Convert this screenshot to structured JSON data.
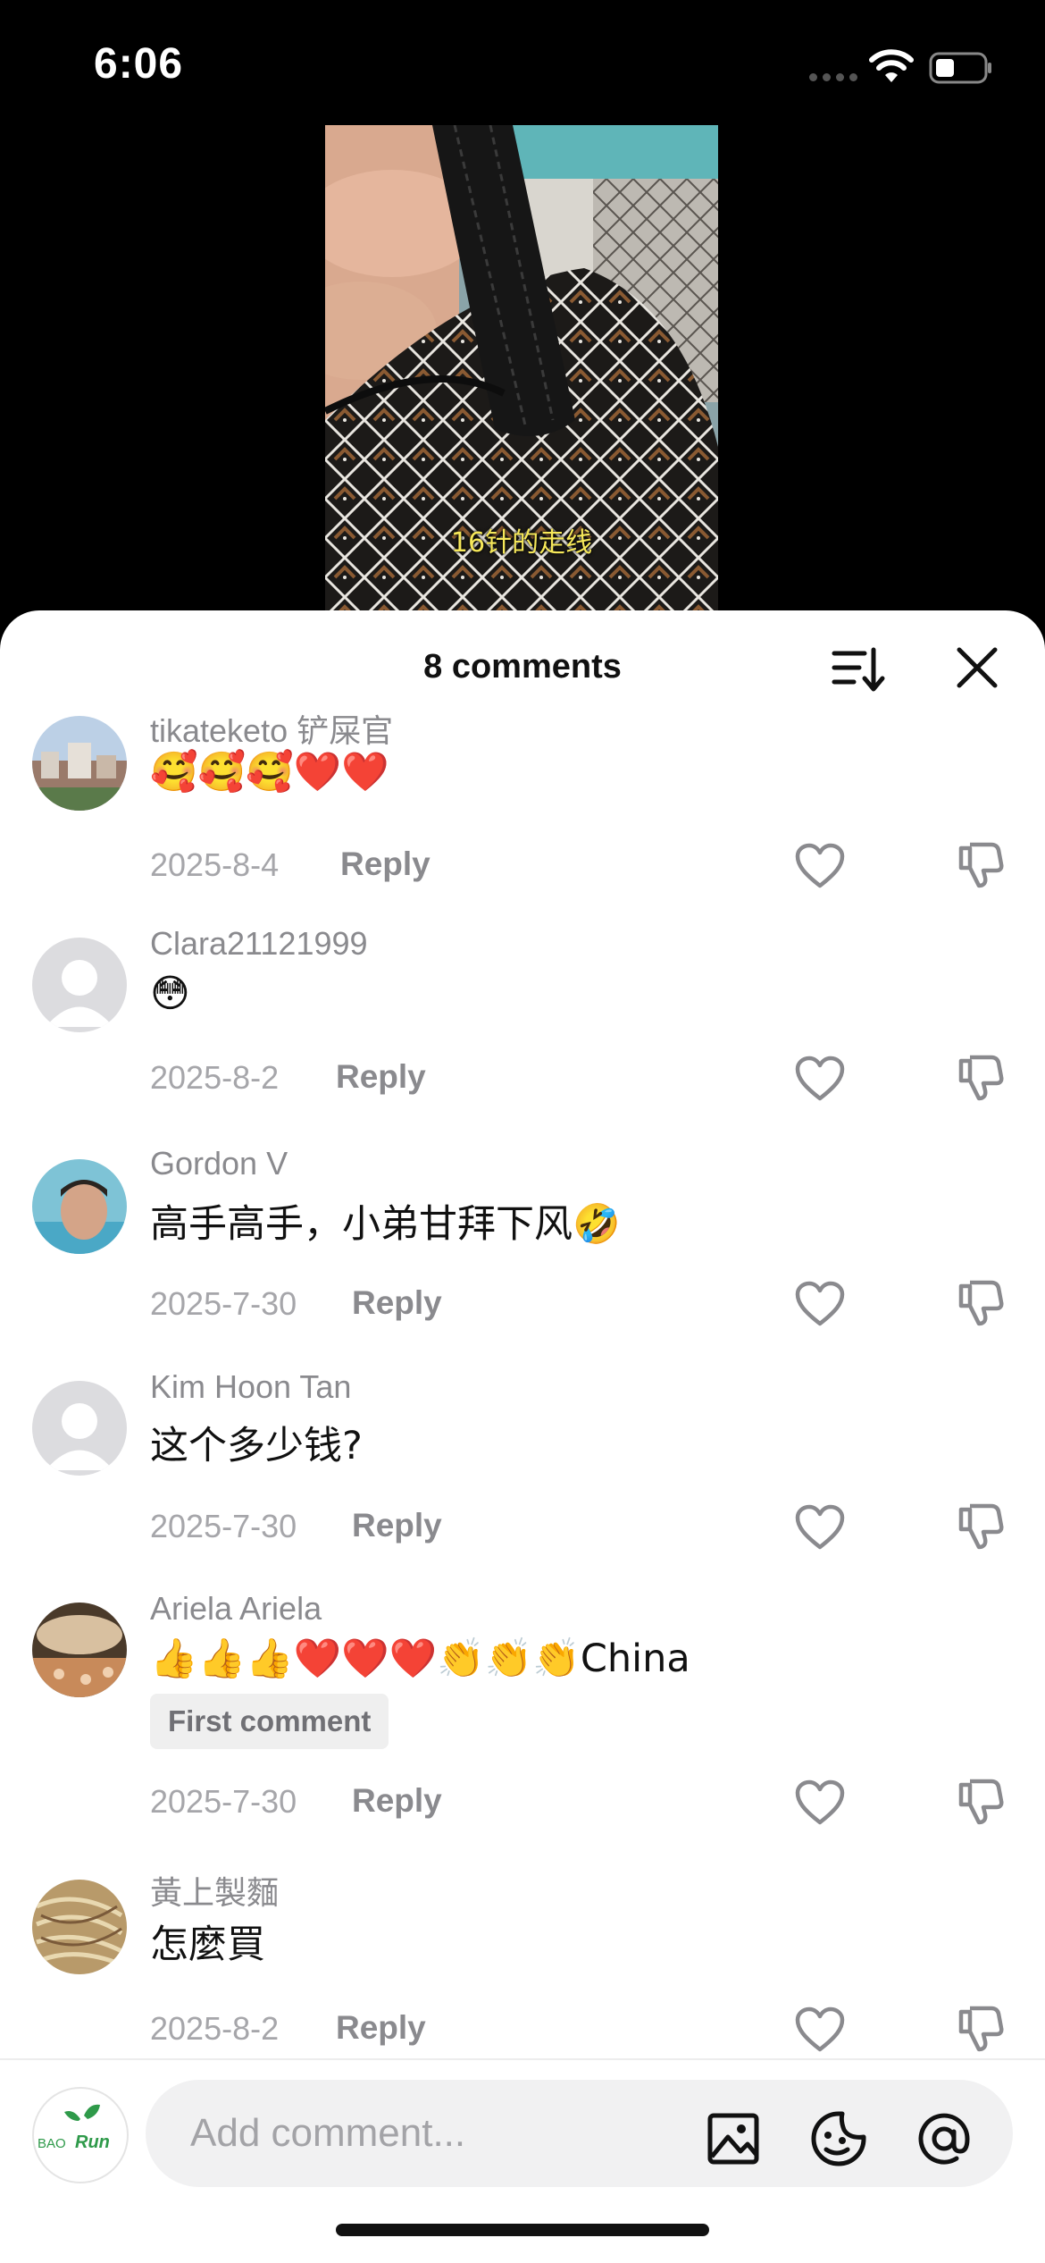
{
  "status_bar": {
    "time": "6:06"
  },
  "video": {
    "caption": "16针的走线"
  },
  "sheet": {
    "title": "8 comments"
  },
  "comments": [
    {
      "user": "tikateketo 铲屎官",
      "text": "🥰🥰🥰❤️❤️",
      "date": "2025-8-4",
      "reply": "Reply"
    },
    {
      "user": "Clara21121999",
      "text": "😳",
      "date": "2025-8-2",
      "reply": "Reply"
    },
    {
      "user": "Gordon V",
      "text": "高手高手，小弟甘拜下风🤣",
      "date": "2025-7-30",
      "reply": "Reply"
    },
    {
      "user": "Kim Hoon Tan",
      "text": "这个多少钱?",
      "date": "2025-7-30",
      "reply": "Reply"
    },
    {
      "user": "Ariela Ariela",
      "text": "👍👍👍❤️❤️❤️👏👏👏China",
      "badge": "First comment",
      "date": "2025-7-30",
      "reply": "Reply"
    },
    {
      "user": "黃上製麵",
      "text": "怎麼買",
      "date": "2025-8-2",
      "reply": "Reply"
    }
  ],
  "composer": {
    "placeholder": "Add comment...",
    "avatar_text_1": "BAO",
    "avatar_text_2": "Run"
  },
  "icons": {
    "sort": "sort-icon",
    "close": "close-icon",
    "like": "heart-outline-icon",
    "dislike": "thumbs-down-icon",
    "image": "image-icon",
    "sticker": "sticker-icon",
    "mention": "at-icon"
  },
  "colors": {
    "accent_green": "#2f9a4a",
    "caption_yellow": "#f6e85a"
  }
}
